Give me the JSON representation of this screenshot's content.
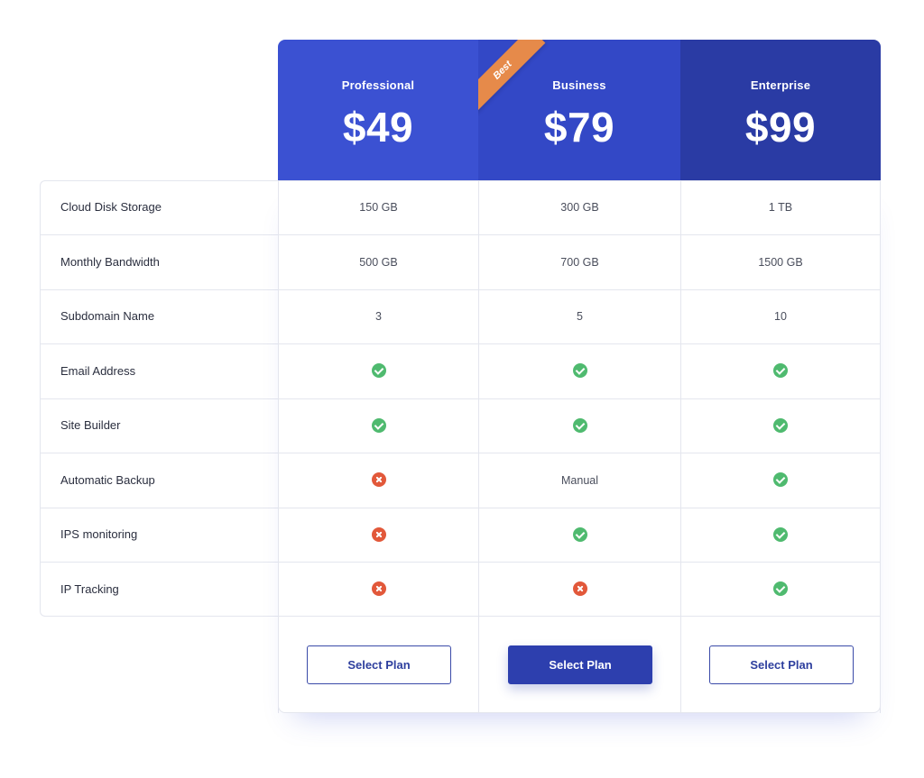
{
  "plans": [
    {
      "name": "Professional",
      "price": "$49",
      "button": "Select Plan"
    },
    {
      "name": "Business",
      "price": "$79",
      "button": "Select Plan",
      "ribbon": "Best"
    },
    {
      "name": "Enterprise",
      "price": "$99",
      "button": "Select Plan"
    }
  ],
  "features": [
    {
      "label": "Cloud Disk Storage",
      "values": [
        "150 GB",
        "300 GB",
        "1 TB"
      ]
    },
    {
      "label": "Monthly Bandwidth",
      "values": [
        "500 GB",
        "700 GB",
        "1500 GB"
      ]
    },
    {
      "label": "Subdomain Name",
      "values": [
        "3",
        "5",
        "10"
      ]
    },
    {
      "label": "Email Address",
      "values": [
        "yes",
        "yes",
        "yes"
      ]
    },
    {
      "label": "Site Builder",
      "values": [
        "yes",
        "yes",
        "yes"
      ]
    },
    {
      "label": "Automatic Backup",
      "values": [
        "no",
        "Manual",
        "yes"
      ]
    },
    {
      "label": "IPS monitoring",
      "values": [
        "no",
        "yes",
        "yes"
      ]
    },
    {
      "label": "IP Tracking",
      "values": [
        "no",
        "no",
        "yes"
      ]
    }
  ],
  "colors": {
    "professional_header": "#3b51d2",
    "business_header": "#3348c6",
    "enterprise_header": "#2a3ba4",
    "ribbon": "#e68a4a",
    "check": "#4fba6f",
    "cross": "#e2583a",
    "primary_button": "#2d3fae"
  },
  "icons": {
    "yes": "check-circle-icon",
    "no": "cross-circle-icon"
  }
}
